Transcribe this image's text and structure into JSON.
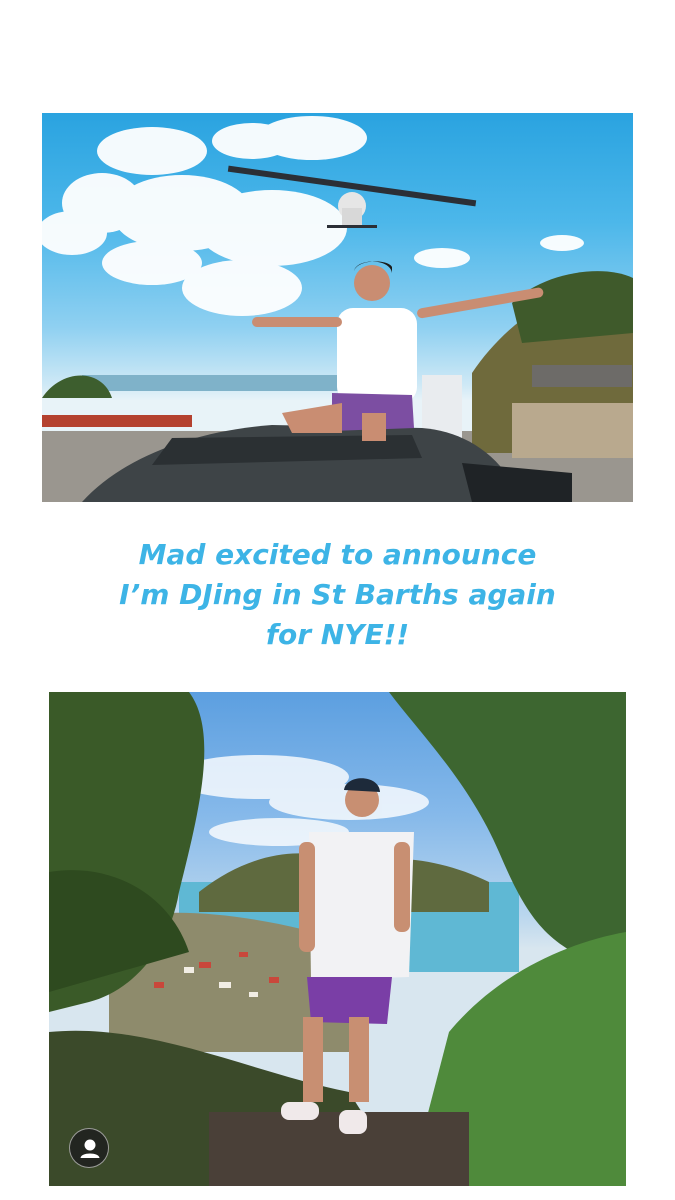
{
  "story": {
    "caption_lines": [
      "Mad excited to announce",
      "I’m DJing in St Barths again",
      "for NYE!!"
    ],
    "caption_color": "#3db4e6"
  },
  "photos": [
    {
      "name": "plane-over-car-photo"
    },
    {
      "name": "overlook-view-photo"
    }
  ],
  "footer": {
    "avatar_icon": "person-icon"
  }
}
